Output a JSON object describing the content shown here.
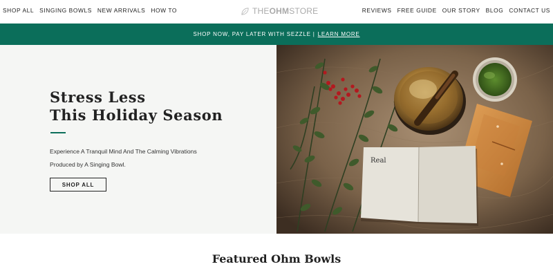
{
  "nav": {
    "left_items": [
      {
        "label": "SHOP ALL"
      },
      {
        "label": "SINGING BOWLS"
      },
      {
        "label": "NEW ARRIVALS"
      },
      {
        "label": "HOW TO"
      }
    ],
    "logo": {
      "part1": "THE",
      "part2": "OHM",
      "part3": "STORE"
    },
    "right_items": [
      {
        "label": "REVIEWS"
      },
      {
        "label": "FREE GUIDE"
      },
      {
        "label": "OUR STORY"
      },
      {
        "label": "BLOG"
      },
      {
        "label": "CONTACT US"
      }
    ]
  },
  "promo": {
    "text": "SHOP NOW, PAY LATER WITH SEZZLE |",
    "link": "LEARN MORE",
    "color": "#0b6e5a"
  },
  "hero": {
    "title_line1": "Stress Less",
    "title_line2": "This Holiday Season",
    "desc_line1": "Experience A Tranquil Mind And The Calming Vibrations",
    "desc_line2": "Produced by A Singing Bowl.",
    "button_label": "SHOP ALL",
    "image": {
      "notebook_text": "Real"
    }
  },
  "featured": {
    "title": "Featured Ohm Bowls"
  }
}
